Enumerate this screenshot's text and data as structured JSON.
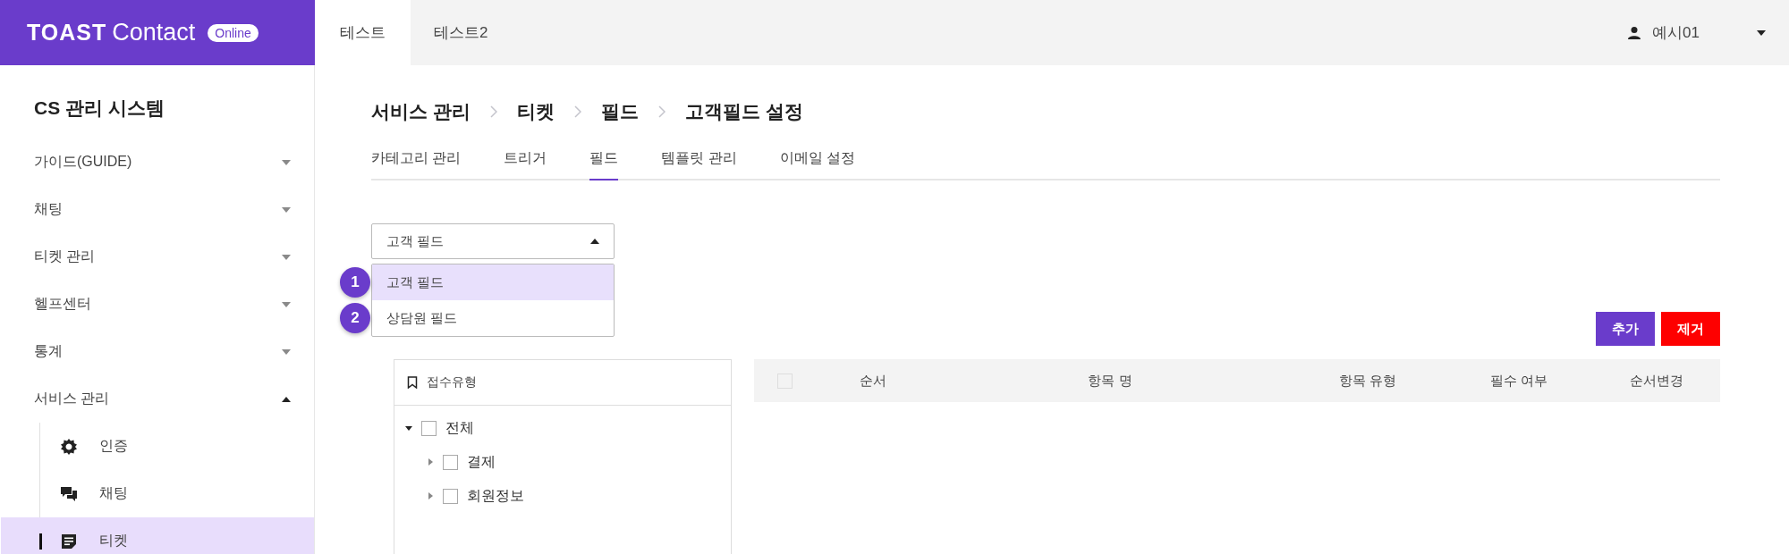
{
  "header": {
    "logo": {
      "brand": "TOAST",
      "product": "Contact",
      "badge": "Online"
    },
    "tabs": [
      {
        "label": "테스트",
        "selected": true
      },
      {
        "label": "테스트2",
        "selected": false
      }
    ],
    "user": {
      "name": "예시01"
    }
  },
  "sidebar": {
    "title": "CS 관리 시스템",
    "items": [
      {
        "label": "가이드(GUIDE)",
        "expanded": false
      },
      {
        "label": "채팅",
        "expanded": false
      },
      {
        "label": "티켓 관리",
        "expanded": false
      },
      {
        "label": "헬프센터",
        "expanded": false
      },
      {
        "label": "통계",
        "expanded": false
      },
      {
        "label": "서비스 관리",
        "expanded": true,
        "children": [
          {
            "label": "인증",
            "selected": false
          },
          {
            "label": "채팅",
            "selected": false
          },
          {
            "label": "티켓",
            "selected": true
          }
        ]
      }
    ]
  },
  "breadcrumb": [
    "서비스 관리",
    "티켓",
    "필드",
    "고객필드 설정"
  ],
  "tabs": [
    {
      "label": "카테고리 관리",
      "selected": false
    },
    {
      "label": "트리거",
      "selected": false
    },
    {
      "label": "필드",
      "selected": true
    },
    {
      "label": "템플릿 관리",
      "selected": false
    },
    {
      "label": "이메일 설정",
      "selected": false
    }
  ],
  "field_select": {
    "value": "고객 필드",
    "open": true,
    "options": [
      {
        "label": "고객 필드",
        "selected": true,
        "marker": "1"
      },
      {
        "label": "상담원 필드",
        "selected": false,
        "marker": "2"
      }
    ]
  },
  "buttons": [
    {
      "label": "추가",
      "kind": "primary"
    },
    {
      "label": "제거",
      "kind": "danger"
    }
  ],
  "tree": {
    "title": "접수유형",
    "nodes": [
      {
        "label": "전체",
        "checked": false,
        "expanded": true,
        "children": [
          {
            "label": "결제",
            "checked": false,
            "expanded": false
          },
          {
            "label": "회원정보",
            "checked": false,
            "expanded": false
          }
        ]
      }
    ]
  },
  "table": {
    "select_all_checked": false,
    "columns": [
      "순서",
      "항목 명",
      "항목 유형",
      "필수 여부",
      "순서변경"
    ]
  }
}
